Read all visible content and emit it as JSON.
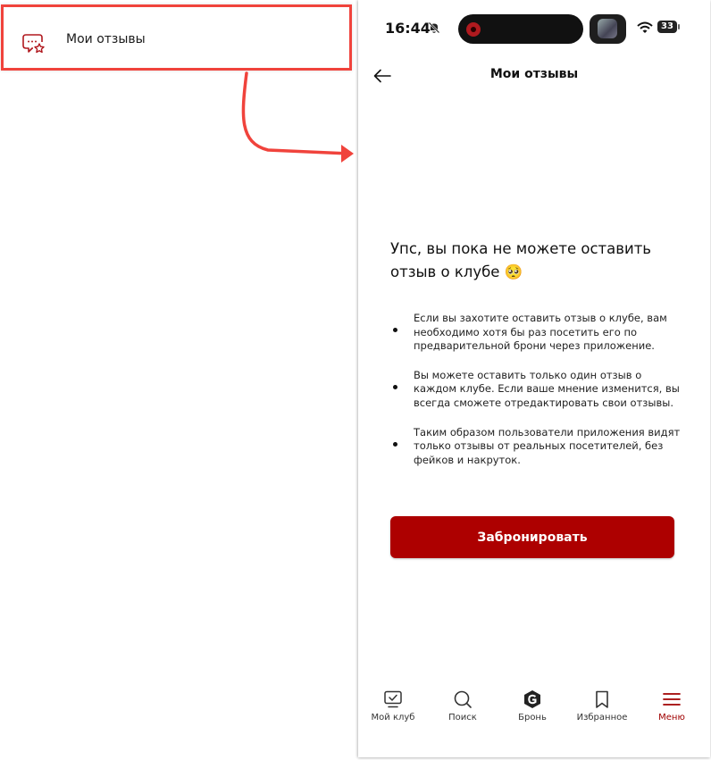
{
  "left_panel": {
    "menu_item_label": "Мои отзывы"
  },
  "status_bar": {
    "time": "16:44",
    "battery": "33"
  },
  "header": {
    "title": "Мои отзывы"
  },
  "empty_state": {
    "title": "Упс, вы пока не можете оставить отзыв о клубе 🥺",
    "bullets": [
      "Если вы захотите оставить отзыв о клубе, вам необходимо хотя бы раз посетить его по предварительной брони через приложение.",
      "Вы можете оставить только один отзыв о каждом клубе. Если ваше мнение изменится, вы всегда сможете отредактировать свои отзывы.",
      "Таким образом пользователи приложения видят только отзывы от реальных посетителей, без фейков и накруток."
    ],
    "button_label": "Забронировать"
  },
  "tabbar": {
    "items": [
      {
        "label": "Мой клуб",
        "icon": "monitor-check-icon"
      },
      {
        "label": "Поиск",
        "icon": "search-icon"
      },
      {
        "label": "Бронь",
        "icon": "logo-icon"
      },
      {
        "label": "Избранное",
        "icon": "bookmark-icon"
      },
      {
        "label": "Меню",
        "icon": "menu-icon"
      }
    ],
    "active": "Меню"
  },
  "colors": {
    "accent": "#ad0000",
    "highlight_border": "#f0433c"
  }
}
